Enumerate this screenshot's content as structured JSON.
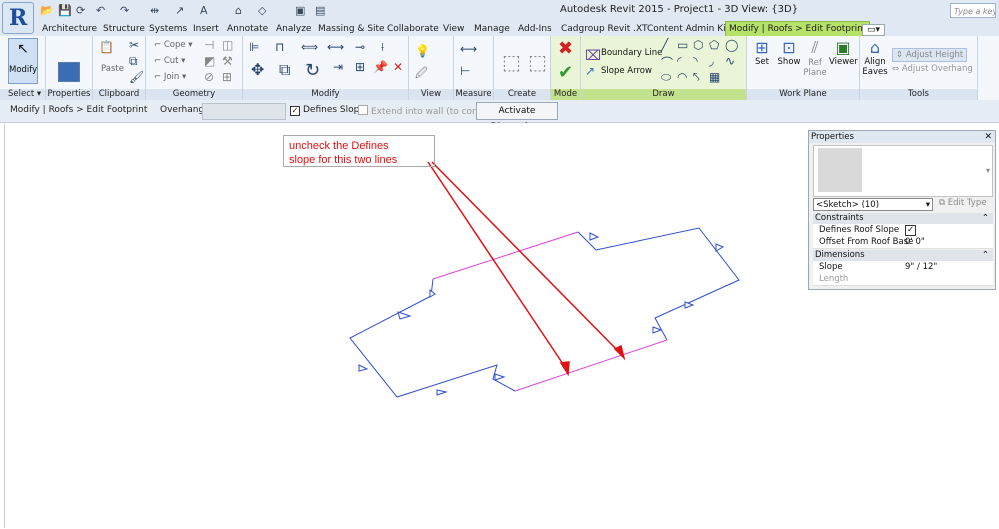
{
  "app": {
    "title": "Autodesk Revit 2015 -    Project1 - 3D View: {3D}",
    "search_placeholder": "Type a keyword"
  },
  "tabs": [
    "Architecture",
    "Structure",
    "Systems",
    "Insert",
    "Annotate",
    "Analyze",
    "Massing & Site",
    "Collaborate",
    "View",
    "Manage",
    "Add-Ins",
    "Cadgroup Revit .XT",
    "Content Admin Kit",
    "Modify | Roofs > Edit Footprint"
  ],
  "ribbon": {
    "modify_label": "Modify",
    "select_label": "Select",
    "properties_label": "Properties",
    "clipboard": {
      "paste": "Paste",
      "cope": "Cope",
      "cut": "Cut",
      "join": "Join",
      "label": "Clipboard"
    },
    "geometry_label": "Geometry",
    "modify_panel_label": "Modify",
    "view_label": "View",
    "measure_label": "Measure",
    "create_label": "Create",
    "mode_label": "Mode",
    "draw": {
      "boundary_line": "Boundary Line",
      "slope_arrow": "Slope Arrow",
      "label": "Draw"
    },
    "workplane": {
      "set": "Set",
      "show": "Show",
      "ref_plane": "Ref Plane",
      "viewer": "Viewer",
      "label": "Work Plane"
    },
    "tools": {
      "align_eaves": "Align Eaves",
      "adjust_height": "Adjust  Height",
      "adjust_overhang": "Adjust  Overhang",
      "label": "Tools"
    }
  },
  "options_bar": {
    "context": "Modify | Roofs > Edit Footprint",
    "overhang_label": "Overhang:",
    "overhang_value": "",
    "defines_slope": "Defines Slope",
    "extend_into_wall": "Extend into wall (to core)",
    "activate_dimensions": "Activate Dimensions"
  },
  "properties": {
    "title": "Properties",
    "type_selector": "<Sketch> (10)",
    "edit_type": "Edit Type",
    "sections": {
      "constraints": "Constraints",
      "dimensions": "Dimensions"
    },
    "rows": {
      "defines_roof_slope": {
        "label": "Defines Roof Slope",
        "value": "✓"
      },
      "offset_from_roof_base": {
        "label": "Offset From Roof Base",
        "value": "0'  0\""
      },
      "slope": {
        "label": "Slope",
        "value": "9\" / 12\""
      },
      "length": {
        "label": "Length",
        "value": ""
      }
    }
  },
  "annotation": {
    "line1": "uncheck the Defines",
    "line2": "slope for this two lines"
  },
  "colors": {
    "accent": "#b7e26a",
    "footprint_blue": "#2d4fd0",
    "footprint_magenta": "#e040e0",
    "annotation_red": "#e01010"
  }
}
